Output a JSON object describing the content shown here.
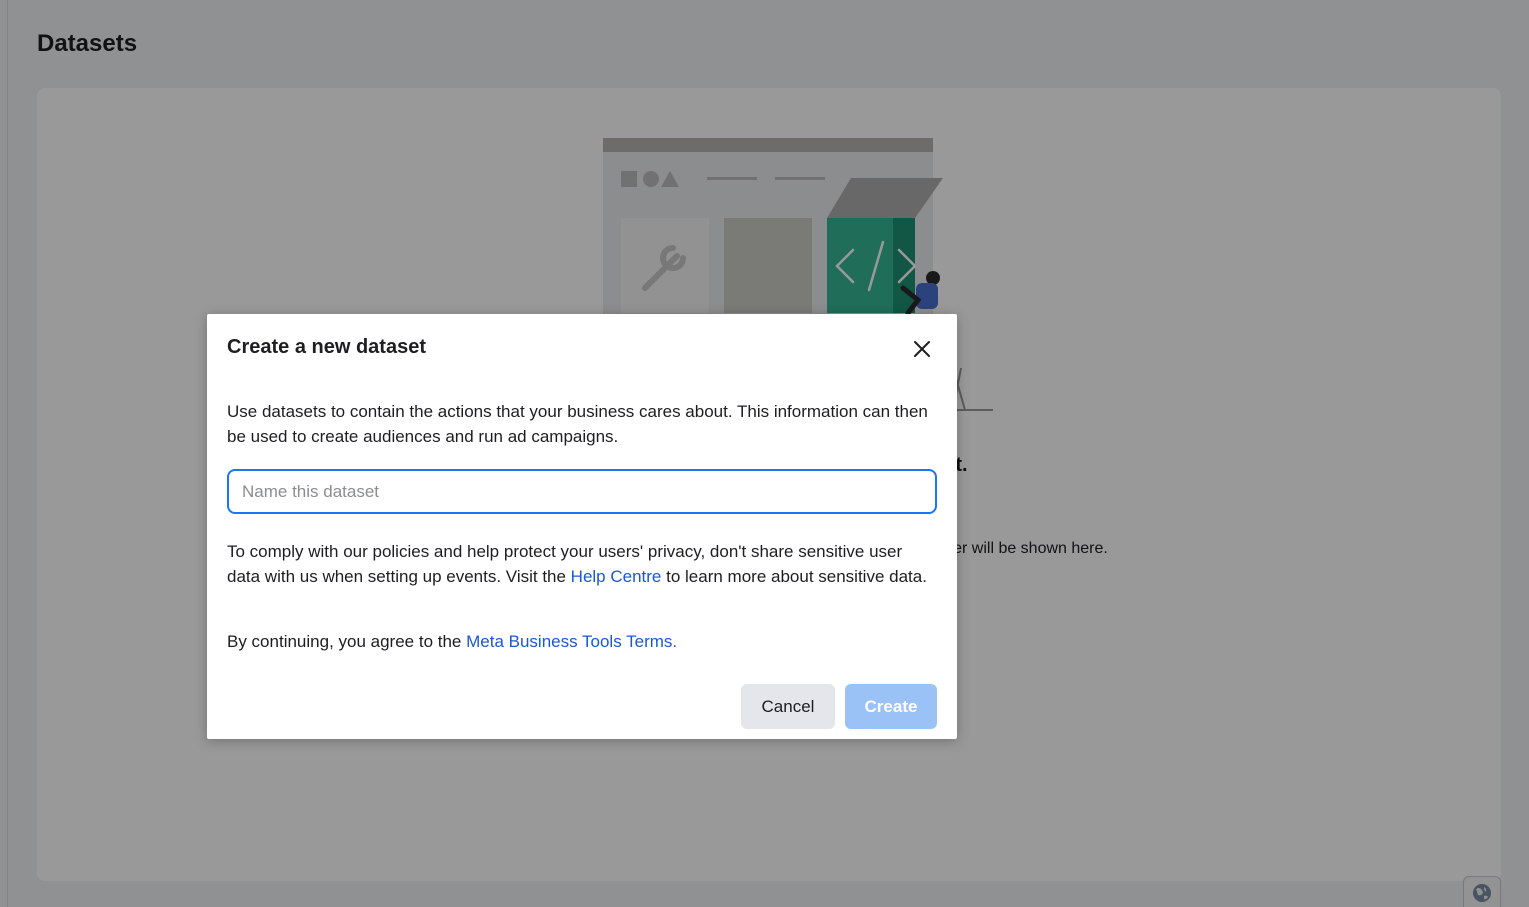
{
  "page": {
    "title": "Datasets"
  },
  "empty_state": {
    "heading": "You don't have any datasets to view yet.",
    "body": "Datasets that you create or that are shared with you in Business Manager will be shown here."
  },
  "modal": {
    "title": "Create a new dataset",
    "description": "Use datasets to contain the actions that your business cares about. This information can then be used to create audiences and run ad campaigns.",
    "input": {
      "placeholder": "Name this dataset",
      "value": ""
    },
    "privacy_before": "To comply with our policies and help protect your users' privacy, don't share sensitive user data with us when setting up events. Visit the ",
    "privacy_link": "Help Centre",
    "privacy_after": " to learn more about sensitive data.",
    "terms_before": "By continuing, you agree to the ",
    "terms_link": "Meta Business Tools Terms.",
    "cancel_label": "Cancel",
    "create_label": "Create",
    "close_icon": "close-icon"
  },
  "icons": {
    "globe": "globe-icon"
  },
  "colors": {
    "accent": "#1877f2",
    "link": "#1a58d4",
    "create_disabled": "#9bc2f7",
    "overlay": "rgba(0,0,0,0.4)",
    "illustration_teal": "#36b694"
  }
}
